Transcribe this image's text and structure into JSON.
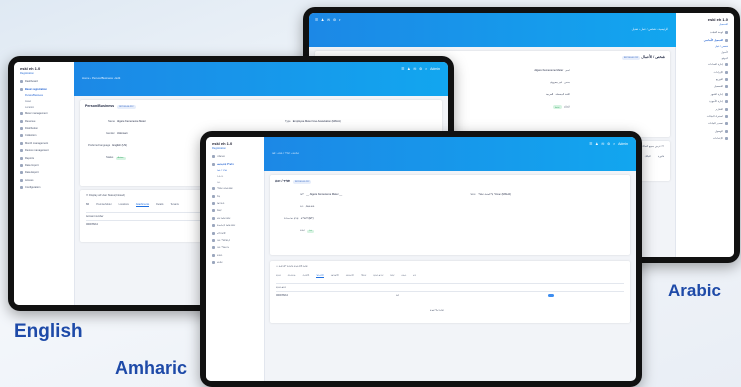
{
  "labels": {
    "english": "English",
    "amharic": "Amharic",
    "arabic": "Arabic"
  },
  "english_screen": {
    "brand": "eskl eh 1.0",
    "brand_sub": "Registration",
    "nav": [
      "Dashboard",
      "Basic registration",
      "Person/Business",
      "Asset",
      "Location",
      "Meter management",
      "Revenue",
      "Distribution",
      "Collection",
      "Month management",
      "Device management",
      "Reports",
      "Data Import",
      "Data Export",
      "Access",
      "Configuration"
    ],
    "crumb": "Home  ›  Person/Business  ›  Edit",
    "card_title": "Person/Business",
    "card_pill": "987-90-00-212",
    "fields": {
      "name_label": "Name",
      "name_value": "Algere Kemeneme Meter",
      "type_label": "Type",
      "type_value": "Employee Meter Use Association (MAUA)",
      "gender_label": "Gender",
      "gender_value": "Unknown",
      "lang_label": "Preferred language",
      "lang_value": "English (US)",
      "status_label": "Status",
      "status_value": "Active"
    },
    "check_label": "Display all User Status(Closed)",
    "tabs": [
      "Bill",
      "Premiseholder",
      "Locations",
      "Attachments",
      "Details",
      "Tenants"
    ],
    "active_tab": "Attachments",
    "row1": "Account number",
    "row2": "000978212"
  },
  "amharic_screen": {
    "brand": "eskl eh 1.0",
    "brand_sub": "Registration",
    "nav": [
      "ዳሽቦርድ",
      "መሰረታዊ ምዝገባ",
      "ሰው / ንግድ",
      "ንብረት",
      "ቦታ",
      "ሜትር አስተዳደር",
      "ገቢ",
      "ስርጭት",
      "ክፍያ",
      "ወር አስተዳደር",
      "የመሳሪያ አስተዳደር",
      "ሪፖርቶች",
      "ዳታ ማስገቢያ",
      "ዳታ ማውጫ",
      "ፍቃድ",
      "ውቅር"
    ],
    "crumb": "ቤት  ›  ሰው / ንግድ  ›  አርትዕ",
    "card_title": "ሰው / ንግድ",
    "card_pill": "987-90-00-212",
    "fields": {
      "name_label": "ስም",
      "name_value": "__ Algere Kemeneme Meter __",
      "type_label": "ዓይነት",
      "type_value": "ሜትር ተጠቃሚ ማህበር (MAUA)",
      "gender_label": "ጾታ",
      "gender_value": "ያልታወቀ",
      "lang_label": "የተመረጠ ቋንቋ",
      "lang_value": "አማርኛ (ET)",
      "status_label": "ሁኔታ",
      "status_value": "ንቁ"
    },
    "check_label": "ሁሉንም የተዘጉ ሁኔታዎች አሳይ",
    "tabs": [
      "ሂሳብ",
      "ባለ ይዞታ",
      "ቦታዎች",
      "ዓባሪዎች",
      "ዝርዝሮች",
      "ተከራዮች",
      "ሜትር",
      "ሂሳብ ቁጥር",
      "ክፍያ",
      "ሁኔታ",
      "ቀን"
    ],
    "active_tab": "ዓባሪዎች",
    "row1": "ሂሳብ ቁጥር",
    "row2": "000978212",
    "row_extra": "አዎ",
    "footer": "ተጨማሪ አሳይ"
  },
  "arabic_screen": {
    "brand": "eskl eh 1.0",
    "brand_sub": "التسجيل",
    "nav": [
      "لوحة القيادة",
      "التسجيل الأساسي",
      "شخص / عمل",
      "الأصول",
      "الموقع",
      "إدارة العدادات",
      "الإيرادات",
      "التوزيع",
      "التحصيل",
      "إدارة الشهر",
      "إدارة الأجهزة",
      "التقارير",
      "استيراد البيانات",
      "تصدير البيانات",
      "الوصول",
      "الإعدادات"
    ],
    "crumb": "الرئيسية  ‹  شخص / عمل  ‹  تعديل",
    "card_title": "شخص / الأعمال",
    "card_pill": "987-90-00-212",
    "fields": {
      "name_label": "اسم",
      "name_value": "Algere Kemeneme Meter",
      "type_label": "نوع",
      "type_value": "جمعية مستخدمي العدادات",
      "gender_label": "جنس",
      "gender_value": "غير معروف",
      "lang_label": "اللغة المفضلة",
      "lang_value": "العربية",
      "status_label": "الحالة",
      "status_value": "نشط"
    },
    "check_label": "عرض جميع الحالات المغلقة",
    "tabs": [
      "فاتورة",
      "المالك",
      "المواقع"
    ]
  },
  "colors": {
    "topbar": "#1c88e6",
    "accent": "#1e5fd0",
    "label": "#1e4aa8",
    "status_green": "#27a05a"
  }
}
